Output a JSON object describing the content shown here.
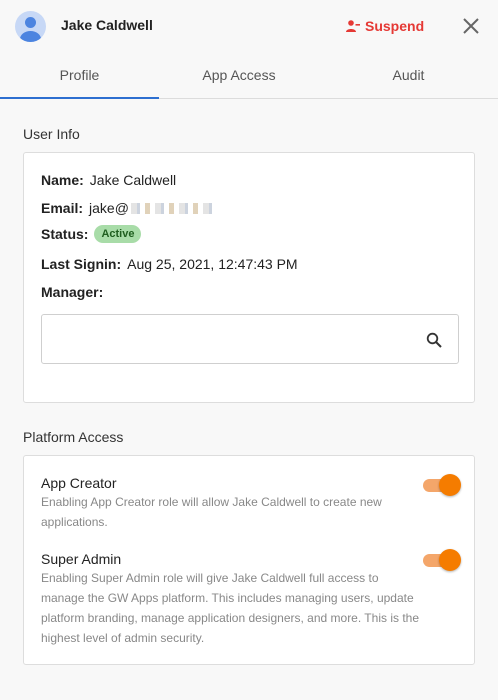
{
  "header": {
    "user_name": "Jake Caldwell",
    "suspend_label": "Suspend"
  },
  "tabs": [
    {
      "label": "Profile",
      "active": true
    },
    {
      "label": "App Access",
      "active": false
    },
    {
      "label": "Audit",
      "active": false
    }
  ],
  "user_info": {
    "section_title": "User Info",
    "name_label": "Name:",
    "name_value": "Jake Caldwell",
    "email_label": "Email:",
    "email_value": "jake@",
    "status_label": "Status:",
    "status_value": "Active",
    "last_signin_label": "Last Signin:",
    "last_signin_value": "Aug 25, 2021, 12:47:43 PM",
    "manager_label": "Manager:",
    "manager_search": {
      "value": "",
      "placeholder": ""
    }
  },
  "platform_access": {
    "section_title": "Platform Access",
    "items": [
      {
        "title": "App Creator",
        "description": "Enabling App Creator role will allow Jake Caldwell to create new applications.",
        "enabled": true
      },
      {
        "title": "Super Admin",
        "description": "Enabling Super Admin role will give Jake Caldwell full access to manage the GW Apps platform. This includes managing users, update platform branding, manage application designers, and more. This is the highest level of admin security.",
        "enabled": true
      }
    ]
  },
  "colors": {
    "accent_tab": "#2d6fd0",
    "suspend": "#e53935",
    "toggle_on": "#f57c00",
    "badge_active": "#a8dca8"
  },
  "icons": {
    "avatar": "avatar-icon",
    "suspend": "person-remove-icon",
    "close": "close-icon",
    "search": "search-icon"
  }
}
